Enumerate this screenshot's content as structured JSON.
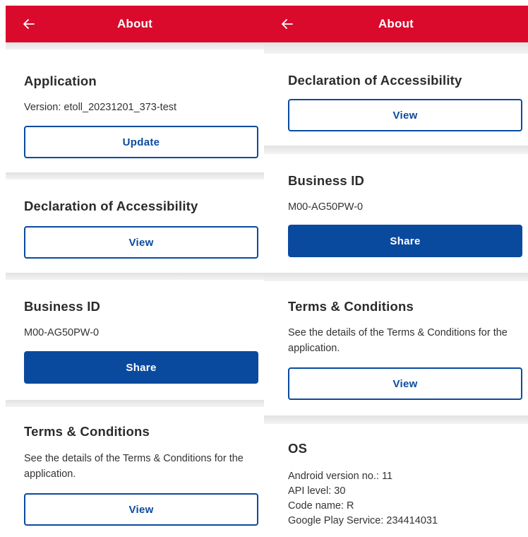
{
  "header": {
    "title": "About"
  },
  "application": {
    "title": "Application",
    "version_text": "Version: etoll_20231201_373-test",
    "update_label": "Update"
  },
  "accessibility": {
    "title": "Declaration of Accessibility",
    "view_label": "View"
  },
  "business_id": {
    "title": "Business ID",
    "value": "M00-AG50PW-0",
    "share_label": "Share"
  },
  "terms": {
    "title": "Terms & Conditions",
    "description": "See the details of the Terms & Conditions for the application.",
    "view_label": "View"
  },
  "os": {
    "title": "OS",
    "android_version": "Android version no.: 11",
    "api_level": "API level: 30",
    "code_name": "Code name: R",
    "play_service": "Google Play Service: 234414031"
  },
  "colors": {
    "header_red": "#d90a2c",
    "primary_blue": "#0a4a9e"
  }
}
